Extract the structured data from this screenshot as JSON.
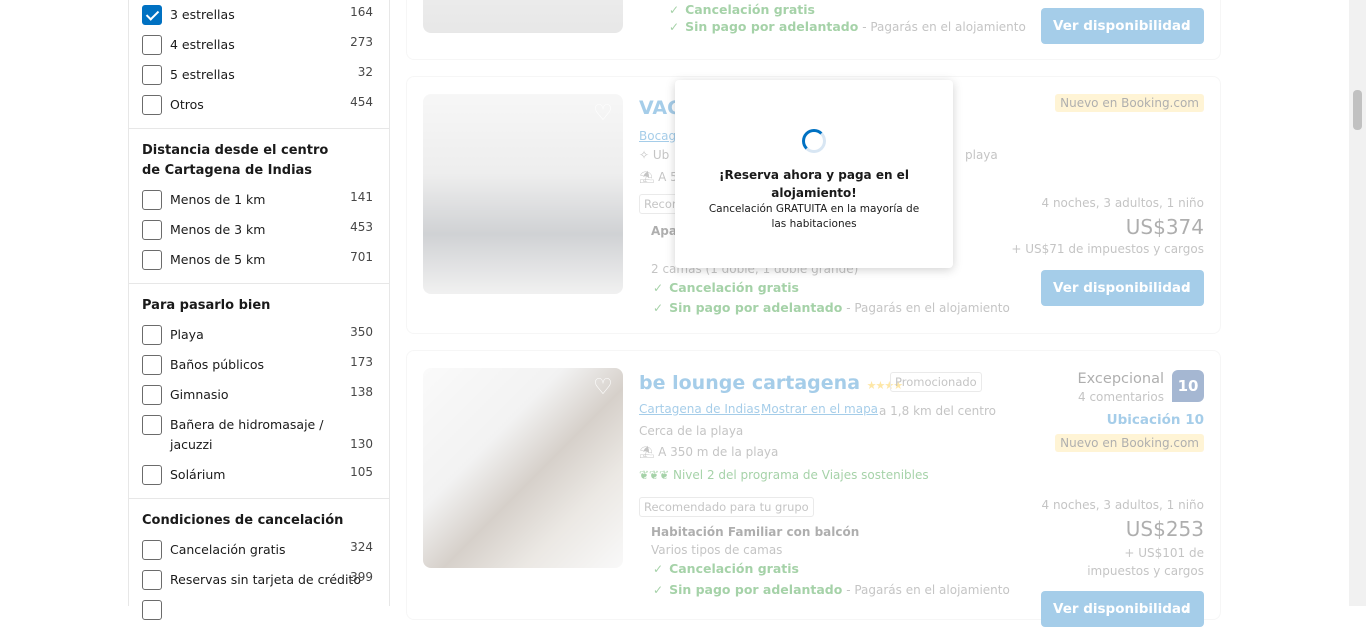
{
  "filters": {
    "stars": [
      {
        "label": "3 estrellas",
        "count": "164",
        "checked": true
      },
      {
        "label": "4 estrellas",
        "count": "273",
        "checked": false
      },
      {
        "label": "5 estrellas",
        "count": "32",
        "checked": false
      },
      {
        "label": "Otros",
        "count": "454",
        "checked": false
      }
    ],
    "distance": {
      "title": "Distancia desde el centro de Cartagena de Indias",
      "items": [
        {
          "label": "Menos de 1 km",
          "count": "141"
        },
        {
          "label": "Menos de 3 km",
          "count": "453"
        },
        {
          "label": "Menos de 5 km",
          "count": "701"
        }
      ]
    },
    "fun": {
      "title": "Para pasarlo bien",
      "items": [
        {
          "label": "Playa",
          "count": "350"
        },
        {
          "label": "Baños públicos",
          "count": "173"
        },
        {
          "label": "Gimnasio",
          "count": "138"
        },
        {
          "label": "Bañera de hidromasaje / jacuzzi",
          "count": "130"
        },
        {
          "label": "Solárium",
          "count": "105"
        }
      ]
    },
    "cancel": {
      "title": "Condiciones de cancelación",
      "items": [
        {
          "label": "Cancelación gratis",
          "count": "324"
        },
        {
          "label": "Reservas sin tarjeta de crédito",
          "count": "399"
        }
      ]
    }
  },
  "card0": {
    "free_cancel": "Cancelación gratis",
    "no_prepay": "Sin pago por adelantado",
    "pay_at": "- Pagarás en el alojamiento",
    "button": "Ver disponibilidad"
  },
  "card1": {
    "title": "VAC",
    "link": "Bocagr",
    "near": "playa",
    "tag": "Recom",
    "unit": "Apar",
    "beds": "2 camas (1 doble, 1 doble grande)",
    "free_cancel": "Cancelación gratis",
    "no_prepay": "Sin pago por adelantado",
    "pay_at": "- Pagarás en el alojamiento",
    "new_badge": "Nuevo en Booking.com",
    "stay": "4 noches, 3 adultos, 1 niño",
    "price": "US$374",
    "taxes": "+ US$71 de impuestos y cargos",
    "button": "Ver disponibilidad",
    "ub": "Ub",
    "a5": "A 5"
  },
  "card2": {
    "title": "be lounge cartagena",
    "promo": "Promocionado",
    "city_link": "Cartagena de Indias",
    "map_link": "Mostrar en el mapa",
    "distance": "a 1,8 km del centro",
    "near_beach": "Cerca de la playa",
    "beach_dist": "A 350 m de la playa",
    "sustain": "Nivel 2 del programa de Viajes sostenibles",
    "tag": "Recomendado para tu grupo",
    "room": "Habitación Familiar con balcón",
    "beds": "Varios tipos de camas",
    "free_cancel": "Cancelación gratis",
    "no_prepay": "Sin pago por adelantado",
    "pay_at": "- Pagarás en el alojamiento",
    "rating_word": "Excepcional",
    "reviews": "4 comentarios",
    "score": "10",
    "location": "Ubicación 10",
    "new_badge": "Nuevo en Booking.com",
    "stay": "4 noches, 3 adultos, 1 niño",
    "price": "US$253",
    "taxes": "+ US$101 de impuestos y cargos",
    "button": "Ver disponibilidad"
  },
  "popup": {
    "title": "¡Reserva ahora y paga en el alojamiento!",
    "subtitle": "Cancelación GRATUITA en la mayoría de las habitaciones"
  },
  "colors": {
    "accent": "#0071c2",
    "green": "#008009",
    "score_bg": "#003580",
    "badge": "#ffe08a"
  }
}
